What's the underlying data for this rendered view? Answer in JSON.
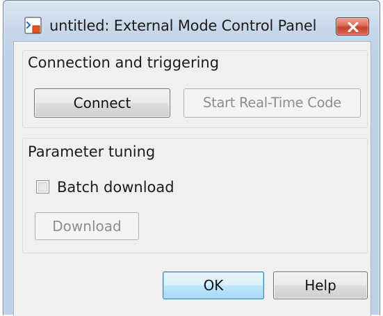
{
  "window": {
    "title": "untitled: External Mode Control Panel",
    "icon": "simulink-model-icon",
    "close_icon": "close-x-icon"
  },
  "connection_group": {
    "label": "Connection and triggering",
    "connect_label": "Connect",
    "start_label": "Start Real-Time Code"
  },
  "parameter_group": {
    "label": "Parameter tuning",
    "batch_label": "Batch download",
    "batch_checked": false,
    "download_label": "Download"
  },
  "footer": {
    "ok_label": "OK",
    "help_label": "Help"
  },
  "colors": {
    "titlebar": "#c9d8ea",
    "client_bg": "#f0f0f0",
    "close_red": "#c5432f",
    "default_button_border": "#3c7fb1"
  }
}
